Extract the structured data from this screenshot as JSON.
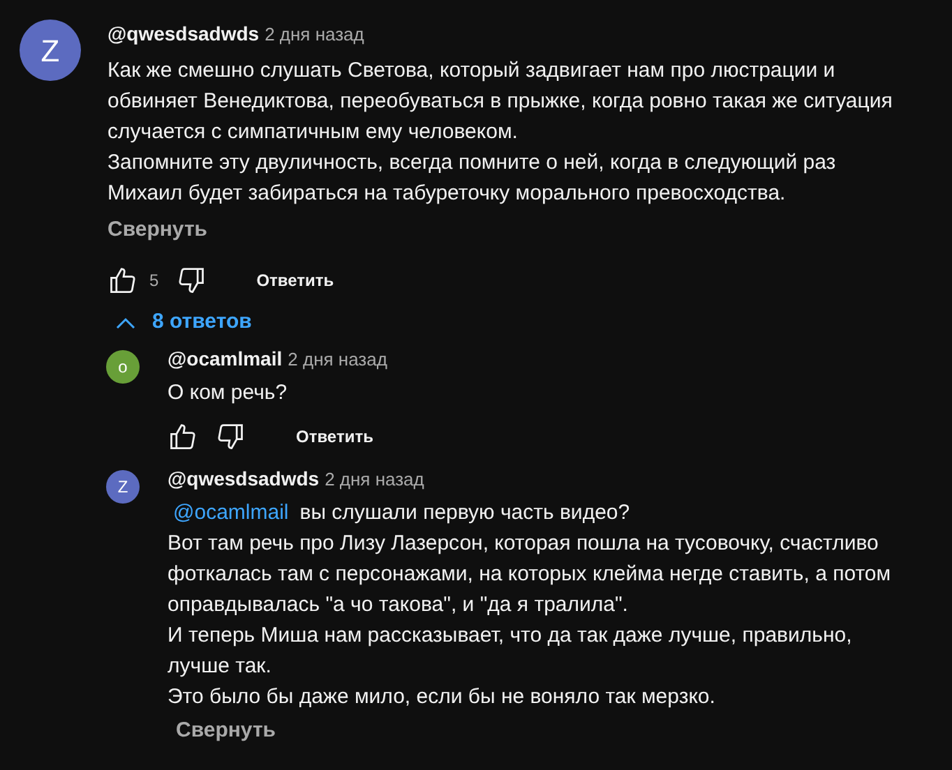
{
  "comment": {
    "avatar_letter": "Z",
    "color": "#5c6bc0",
    "author": "@qwesdsadwds",
    "time": "2 дня назад",
    "lines": [
      "Как же смешно слушать Светова, который задвигает нам про люстрации и",
      "обвиняет Венедиктова, переобуваться в прыжке, когда ровно такая же ситуация",
      "случается с симпатичным ему человеком.",
      "Запомните эту двуличность, всегда помните о ней, когда в следующий раз",
      "Михаил будет забираться на табуреточку морального превосходства."
    ],
    "collapse": "Свернуть",
    "likes": "5",
    "reply_button": "Ответить"
  },
  "replies_toggle": {
    "label": "8 ответов",
    "expanded": true
  },
  "replies": [
    {
      "avatar_letter": "o",
      "color": "#689f38",
      "author": "@ocamlmail",
      "time": "2 дня назад",
      "lines": [
        "О ком речь?"
      ],
      "reply_button": "Ответить"
    },
    {
      "avatar_letter": "Z",
      "color": "#5c6bc0",
      "author": "@qwesdsadwds",
      "time": "2 дня назад",
      "mention": "@ocamlmail",
      "first_line": "вы слушали первую часть видео?",
      "lines": [
        "Вот там речь про Лизу Лазерсон, которая пошла на тусовочку, счастливо",
        "фоткалась там с персонажами, на которых клейма негде ставить, а потом",
        "оправдывалась \"а чо такова\", и \"да я тралила\".",
        "И теперь Миша нам рассказывает, что да так даже лучше, правильно,",
        "лучше так.",
        "Это было бы даже мило, если бы не воняло так мерзко."
      ],
      "collapse": "Свернуть"
    }
  ]
}
